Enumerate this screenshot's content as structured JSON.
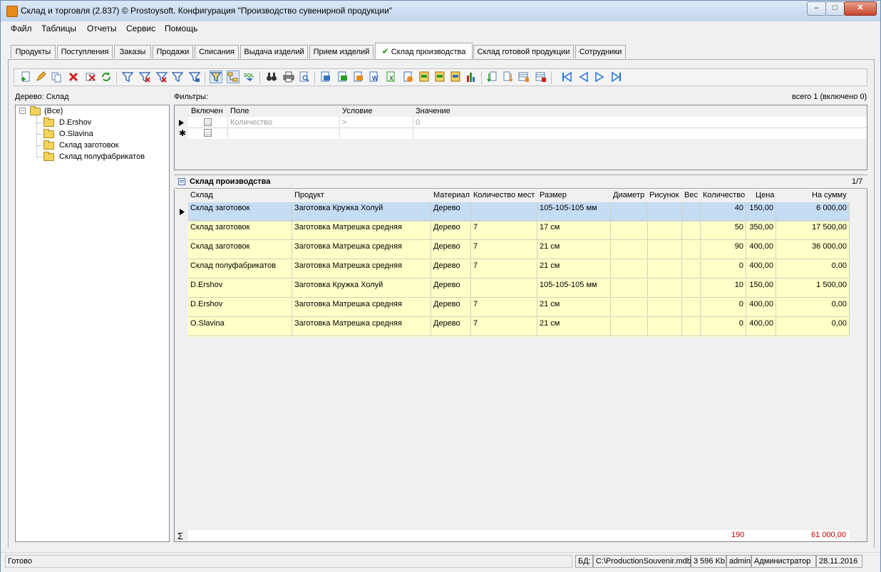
{
  "window": {
    "title": "Склад и торговля (2.837) © Prostoysoft. Конфигурация \"Производство сувенирной продукции\"",
    "minimize": "–",
    "maximize": "□",
    "close": "✕"
  },
  "menu": [
    "Файл",
    "Таблицы",
    "Отчеты",
    "Сервис",
    "Помощь"
  ],
  "tabs": [
    {
      "label": "Продукты"
    },
    {
      "label": "Поступления"
    },
    {
      "label": "Заказы"
    },
    {
      "label": "Продажи"
    },
    {
      "label": "Списания"
    },
    {
      "label": "Выдача изделий"
    },
    {
      "label": "Прием изделий"
    },
    {
      "label": "Склад производства",
      "check": "✔"
    },
    {
      "label": "Склад готовой продукции"
    },
    {
      "label": "Сотрудники"
    }
  ],
  "tree": {
    "title": "Дерево: Склад",
    "root": "(Все)",
    "items": [
      "D.Ershov",
      "O.Slavina",
      "Склад заготовок",
      "Склад полуфабрикатов"
    ]
  },
  "filters": {
    "title": "Фильтры:",
    "summary": "всего 1 (включено 0)",
    "columns": [
      "Включен",
      "Поле",
      "Условие",
      "Значение"
    ],
    "rows": [
      {
        "field": "Количество",
        "condition": ">",
        "value": "0"
      }
    ]
  },
  "panel": {
    "title": "Склад производства",
    "page": "1/7"
  },
  "grid": {
    "columns": [
      "Склад",
      "Продукт",
      "Материал",
      "Количество мест",
      "Размер",
      "Диаметр",
      "Рисунок",
      "Вес",
      "Количество",
      "Цена",
      "На сумму"
    ],
    "rows": [
      [
        "Склад заготовок",
        "Заготовка Кружка Холуй",
        "Дерево",
        "",
        "105-105-105 мм",
        "",
        "",
        "",
        "40",
        "150,00",
        "6 000,00"
      ],
      [
        "Склад заготовок",
        "Заготовка Матрешка средняя",
        "Дерево",
        "7",
        "17 см",
        "",
        "",
        "",
        "50",
        "350,00",
        "17 500,00"
      ],
      [
        "Склад заготовок",
        "Заготовка Матрешка средняя",
        "Дерево",
        "7",
        "21 см",
        "",
        "",
        "",
        "90",
        "400,00",
        "36 000,00"
      ],
      [
        "Склад полуфабрикатов",
        "Заготовка Матрешка средняя",
        "Дерево",
        "7",
        "21 см",
        "",
        "",
        "",
        "0",
        "400,00",
        "0,00"
      ],
      [
        "D.Ershov",
        "Заготовка Кружка Холуй",
        "Дерево",
        "",
        "105-105-105 мм",
        "",
        "",
        "",
        "10",
        "150,00",
        "1 500,00"
      ],
      [
        "D.Ershov",
        "Заготовка Матрешка средняя",
        "Дерево",
        "7",
        "21 см",
        "",
        "",
        "",
        "0",
        "400,00",
        "0,00"
      ],
      [
        "O.Slavina",
        "Заготовка Матрешка средняя",
        "Дерево",
        "7",
        "21 см",
        "",
        "",
        "",
        "0",
        "400,00",
        "0,00"
      ]
    ],
    "footer": {
      "sigma": "Σ",
      "qty_total": "190",
      "sum_total": "61 000,00"
    }
  },
  "status": {
    "state": "Готово",
    "db_label": "БД:",
    "db_path": "C:\\ProductionSouvenir.mdb",
    "db_size": "3 596 Kb",
    "user": "admin",
    "role": "Администратор",
    "date": "28.11.2016"
  },
  "colors": {
    "row_yellow": "#ffffc8",
    "row_selected": "#c5dcf5",
    "total_red": "#c00000",
    "check_green": "#2a8a1f"
  }
}
